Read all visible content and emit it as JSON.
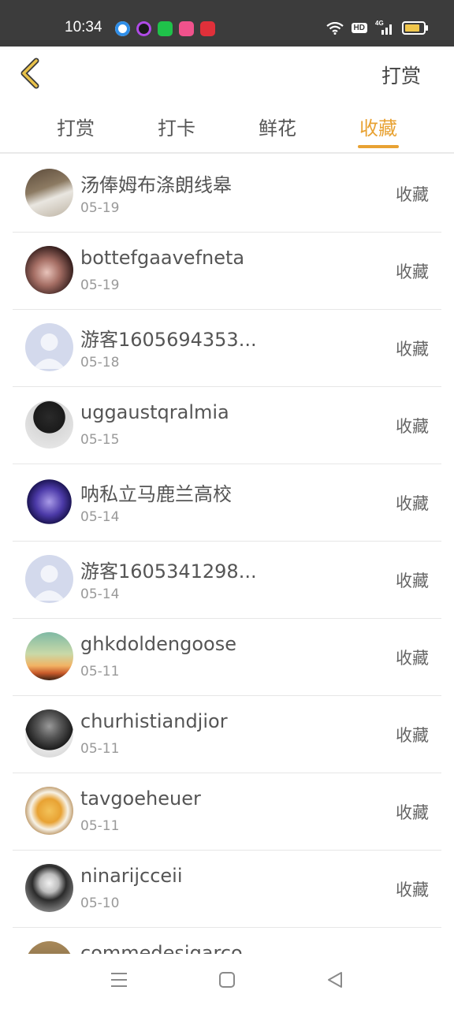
{
  "status_bar": {
    "time": "10:34",
    "hd_label": "HD",
    "network": "4G"
  },
  "header": {
    "back_icon": "chevron-left-icon",
    "action_label": "打赏"
  },
  "tabs": [
    {
      "label": "打赏",
      "active": false
    },
    {
      "label": "打卡",
      "active": false
    },
    {
      "label": "鲜花",
      "active": false
    },
    {
      "label": "收藏",
      "active": true
    }
  ],
  "colors": {
    "accent": "#e8a233",
    "status_bar": "#3c3c3c",
    "divider": "#e6e6e6"
  },
  "records": [
    {
      "name": "汤俸姆布涤朗线皋",
      "date": "05-19",
      "type": "收藏",
      "avatar": "photo-person-white"
    },
    {
      "name": "bottefgaavefneta",
      "date": "05-19",
      "type": "收藏",
      "avatar": "photo-woman-portrait"
    },
    {
      "name": "游客1605694353...",
      "date": "05-18",
      "type": "收藏",
      "avatar": "default-avatar"
    },
    {
      "name": "uggaustqralmia",
      "date": "05-15",
      "type": "收藏",
      "avatar": "anime-character"
    },
    {
      "name": "呐私立马鹿兰高校",
      "date": "05-14",
      "type": "收藏",
      "avatar": "game-emblem"
    },
    {
      "name": "游客1605341298...",
      "date": "05-14",
      "type": "收藏",
      "avatar": "default-avatar"
    },
    {
      "name": "ghkdoldengoose",
      "date": "05-11",
      "type": "收藏",
      "avatar": "sunset-plant"
    },
    {
      "name": "churhistiandjior",
      "date": "05-11",
      "type": "收藏",
      "avatar": "man-bw-portrait"
    },
    {
      "name": "tavgoeheuer",
      "date": "05-11",
      "type": "收藏",
      "avatar": "food-bowl"
    },
    {
      "name": "ninarijcceii",
      "date": "05-10",
      "type": "收藏",
      "avatar": "anime-girl-bw"
    },
    {
      "name": "commedesigarco",
      "date": "",
      "type": "",
      "avatar": "landscape-photo"
    }
  ],
  "nav_bar": {
    "menu_icon": "menu-icon",
    "home_icon": "home-square-icon",
    "back_icon": "back-triangle-icon"
  }
}
